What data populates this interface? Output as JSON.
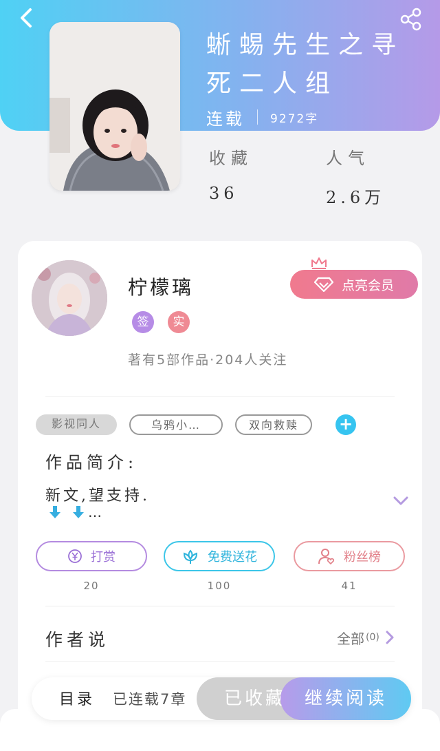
{
  "header": {
    "title": "蜥蜴先生之寻死二人组",
    "status": "连载",
    "word_count": "9272字",
    "stats": [
      {
        "label": "收藏",
        "value": "36"
      },
      {
        "label": "人气",
        "value": "2.6万"
      }
    ]
  },
  "author": {
    "name": "柠檬璃",
    "badges": [
      "签",
      "实"
    ],
    "meta": "著有5部作品·204人关注",
    "vip_button": "点亮会员"
  },
  "tags": [
    "影视同人",
    "乌鸦小…",
    "双向救赎"
  ],
  "intro": {
    "title": "作品简介:",
    "text": "新文,望支持.",
    "more": "…"
  },
  "actions": [
    {
      "label": "打赏",
      "count": "20",
      "icon": "yen-coin-icon"
    },
    {
      "label": "免费送花",
      "count": "100",
      "icon": "flower-icon"
    },
    {
      "label": "粉丝榜",
      "count": "41",
      "icon": "fan-user-icon"
    }
  ],
  "author_says": {
    "title": "作者说",
    "all_label": "全部",
    "all_count": "(0)"
  },
  "bottom_bar": {
    "toc_label": "目录",
    "chapters": "已连载7章",
    "favorite": "已收藏",
    "continue": "继续阅读"
  },
  "colors": {
    "header_gradient_start": "#4fd1f4",
    "header_gradient_end": "#b59ae8",
    "vip": "#f07a8e",
    "accent_blue": "#36c4f0",
    "accent_purple": "#b48be0",
    "accent_pink": "#ea9aa0"
  }
}
